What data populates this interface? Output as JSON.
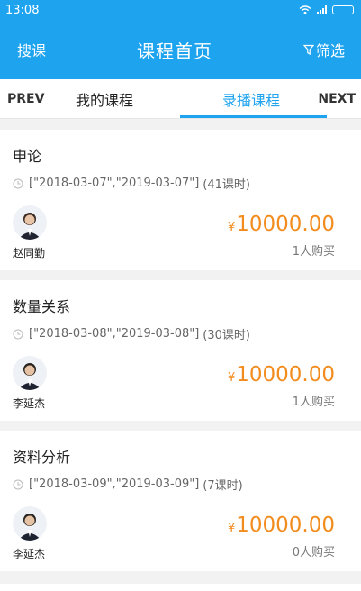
{
  "status": {
    "time": "13:08"
  },
  "appbar": {
    "search_label": "搜课",
    "title": "课程首页",
    "filter_label": "筛选"
  },
  "tabs": {
    "prev": "PREV",
    "next": "NEXT",
    "items": [
      {
        "label": "我的课程"
      },
      {
        "label": "录播课程"
      }
    ]
  },
  "colors": {
    "brand": "#1ea3ef",
    "price": "#f28c1e"
  },
  "courses": [
    {
      "name": "申论",
      "dates": "[\"2018-03-07\",\"2019-03-07\"]",
      "hours": "(41课时)",
      "teacher": "赵同勤",
      "currency": "¥",
      "price": "10000.00",
      "buyers": "1人购买"
    },
    {
      "name": "数量关系",
      "dates": "[\"2018-03-08\",\"2019-03-08\"]",
      "hours": "(30课时)",
      "teacher": "李延杰",
      "currency": "¥",
      "price": "10000.00",
      "buyers": "1人购买"
    },
    {
      "name": "资料分析",
      "dates": "[\"2018-03-09\",\"2019-03-09\"]",
      "hours": "(7课时)",
      "teacher": "李延杰",
      "currency": "¥",
      "price": "10000.00",
      "buyers": "0人购买"
    }
  ]
}
